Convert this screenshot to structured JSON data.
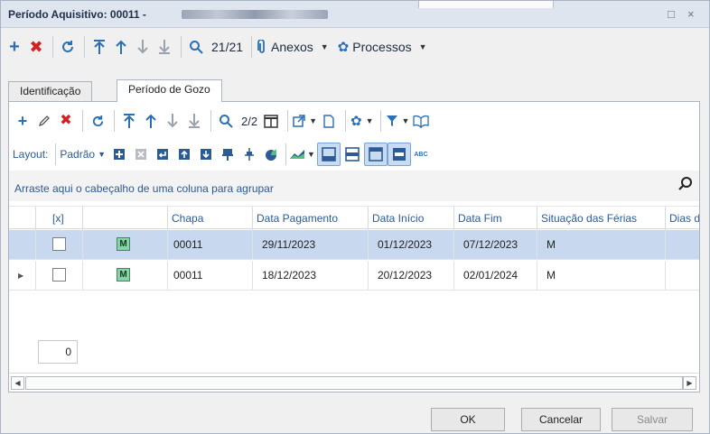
{
  "window": {
    "title": "Período Aquisitivo: 00011 -",
    "maximize_glyph": "□",
    "close_glyph": "×"
  },
  "main_toolbar": {
    "record_count": "21/21",
    "attachments_label": "Anexos",
    "processes_label": "Processos"
  },
  "tabs": [
    {
      "label": "Identificação",
      "active": false
    },
    {
      "label": "Período de Gozo",
      "active": true
    }
  ],
  "grid_toolbar": {
    "record_count": "2/2",
    "layout_label": "Layout:",
    "layout_value": "Padrão"
  },
  "group_bar": {
    "text": "Arraste aqui o cabeçalho de uma coluna para agrupar"
  },
  "columns": [
    "[x]",
    "",
    "Chapa",
    "Data Pagamento",
    "Data Início",
    "Data Fim",
    "Situação das Férias",
    "Dias d"
  ],
  "rows": [
    {
      "checked": false,
      "badge": "M",
      "chapa": "00011",
      "data_pagamento": "29/11/2023",
      "data_inicio": "01/12/2023",
      "data_fim": "07/12/2023",
      "situacao": "M",
      "selected": true
    },
    {
      "checked": false,
      "badge": "M",
      "chapa": "00011",
      "data_pagamento": "18/12/2023",
      "data_inicio": "20/12/2023",
      "data_fim": "02/01/2024",
      "situacao": "M",
      "selected": false
    }
  ],
  "footer": {
    "count": "0"
  },
  "buttons": {
    "ok": "OK",
    "cancel": "Cancelar",
    "save": "Salvar"
  },
  "colors": {
    "accent": "#2b6fb7",
    "delete": "#d21f1f",
    "selection": "#c7d8ef",
    "badge": "#86d3a6"
  }
}
